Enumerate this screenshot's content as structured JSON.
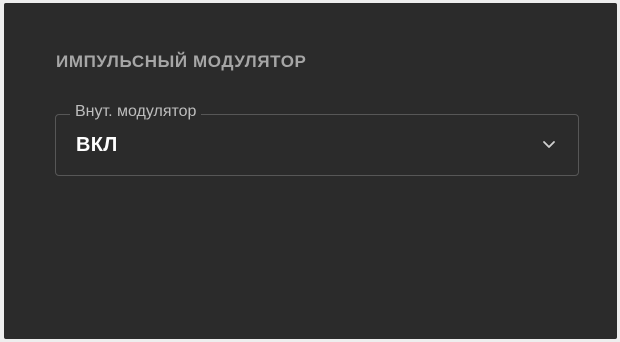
{
  "section": {
    "title": "ИМПУЛЬСНЫЙ МОДУЛЯТОР"
  },
  "modulator_select": {
    "label": "Внут. модулятор",
    "value": "ВКЛ",
    "icon": "chevron-down-icon"
  },
  "colors": {
    "panel_background": "#2b2b2b",
    "title_text": "#a6a6a6",
    "field_border": "#575757",
    "value_text": "#ffffff"
  }
}
